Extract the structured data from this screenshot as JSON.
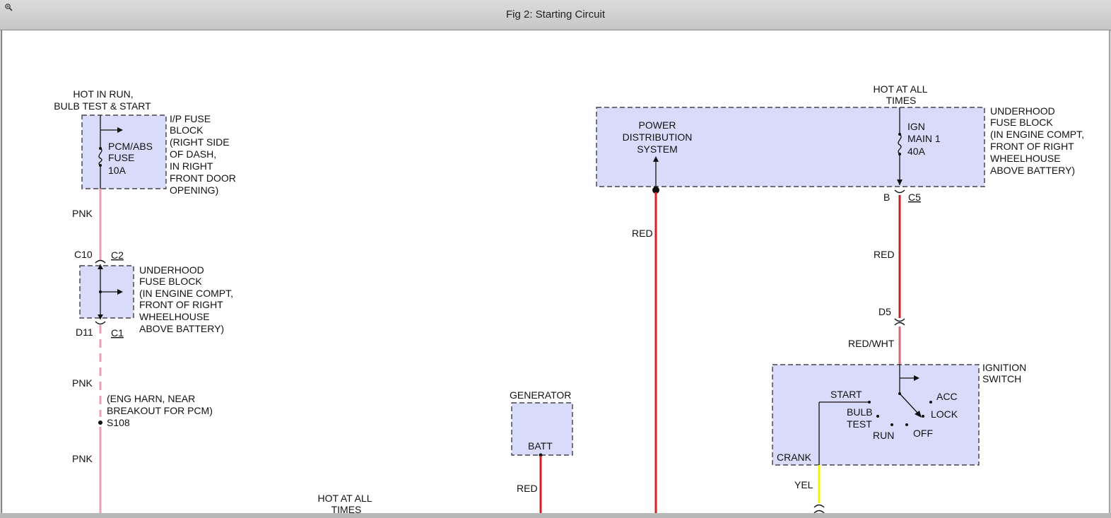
{
  "window": {
    "title": "Fig 2: Starting Circuit",
    "zoom_icon": "magnifier-zoom-icon"
  },
  "colors": {
    "box_fill": "#d9dbfb",
    "pink_wire": "#e8a0b4",
    "red_wire": "#d81f26",
    "yellow_wire": "#f4f000"
  },
  "diagram": {
    "hot_run_top": "HOT IN RUN,",
    "hot_run_bottom": "BULB TEST & START",
    "pcm_fuse_1": "PCM/ABS",
    "pcm_fuse_2": "FUSE",
    "pcm_fuse_3": "10A",
    "ip_block_1": "I/P FUSE",
    "ip_block_2": "BLOCK",
    "ip_block_3": "(RIGHT SIDE",
    "ip_block_4": "OF DASH,",
    "ip_block_5": "IN RIGHT",
    "ip_block_6": "FRONT DOOR",
    "ip_block_7": "OPENING)",
    "pnk_1": "PNK",
    "pnk_2": "PNK",
    "pnk_3": "PNK",
    "c10": "C10",
    "c2": "C2",
    "d11": "D11",
    "c1": "C1",
    "uh_left_1": "UNDERHOOD",
    "uh_left_2": "FUSE BLOCK",
    "uh_left_3": "(IN ENGINE COMPT,",
    "uh_left_4": "FRONT OF RIGHT",
    "uh_left_5": "WHEELHOUSE",
    "uh_left_6": "ABOVE BATTERY)",
    "eng_harn_1": "(ENG HARN, NEAR",
    "eng_harn_2": "BREAKOUT FOR PCM)",
    "s108": "S108",
    "hot_all_bottom_1": "HOT AT ALL",
    "hot_all_bottom_2": "TIMES",
    "generator": "GENERATOR",
    "batt": "BATT",
    "red_gen": "RED",
    "pds_1": "POWER",
    "pds_2": "DISTRIBUTION",
    "pds_3": "SYSTEM",
    "red_pds": "RED",
    "hot_all_top_1": "HOT AT ALL",
    "hot_all_top_2": "TIMES",
    "ign_1": "IGN",
    "ign_2": "MAIN 1",
    "ign_3": "40A",
    "uh_right_1": "UNDERHOOD",
    "uh_right_2": "FUSE BLOCK",
    "uh_right_3": "(IN ENGINE COMPT,",
    "uh_right_4": "FRONT OF RIGHT",
    "uh_right_5": "WHEELHOUSE",
    "uh_right_6": "ABOVE BATTERY)",
    "b": "B",
    "c5": "C5",
    "red_right": "RED",
    "d5": "D5",
    "red_wht": "RED/WHT",
    "ign_switch_1": "IGNITION",
    "ign_switch_2": "SWITCH",
    "start": "START",
    "acc": "ACC",
    "lock": "LOCK",
    "bulb": "BULB",
    "test": "TEST",
    "run": "RUN",
    "off": "OFF",
    "crank": "CRANK",
    "yel": "YEL"
  }
}
